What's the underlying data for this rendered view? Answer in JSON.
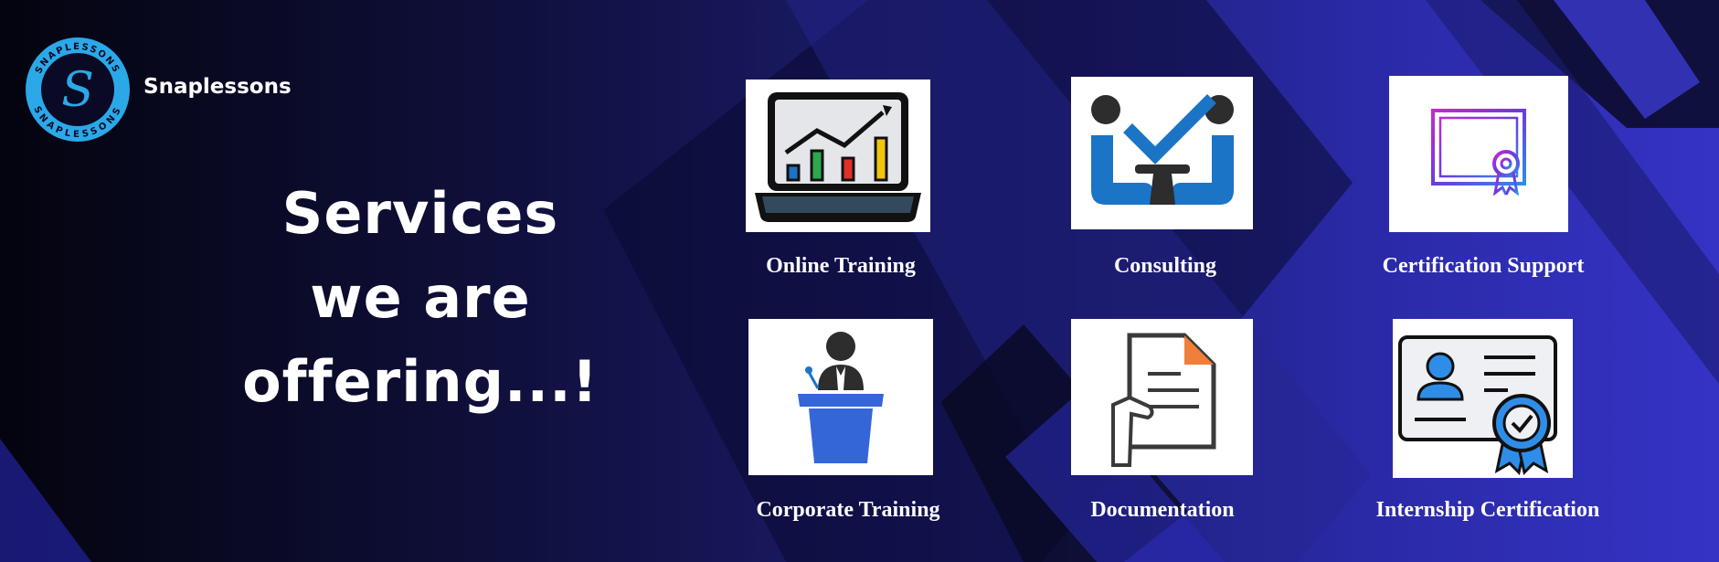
{
  "brand": {
    "name": "Snaplessons",
    "logo_text": "SNAPLESSONS",
    "logo_letter": "S",
    "logo_colors": {
      "ring": "#2ba8e8",
      "inner": "#0a0a24"
    }
  },
  "headline": {
    "line1": "Services",
    "line2": "we are",
    "line3": "offering...!"
  },
  "services": [
    {
      "label": "Online Training",
      "icon": "laptop-chart-icon"
    },
    {
      "label": "Consulting",
      "icon": "consulting-handshake-icon"
    },
    {
      "label": "Certification Support",
      "icon": "certificate-icon"
    },
    {
      "label": "Corporate Training",
      "icon": "podium-speaker-icon"
    },
    {
      "label": "Documentation",
      "icon": "document-icon"
    },
    {
      "label": "Internship Certification",
      "icon": "id-card-badge-icon"
    }
  ],
  "colors": {
    "background_dark": "#04040f",
    "background_blue": "#3533c4",
    "accent_blue": "#1b74c5",
    "text": "#ffffff"
  }
}
